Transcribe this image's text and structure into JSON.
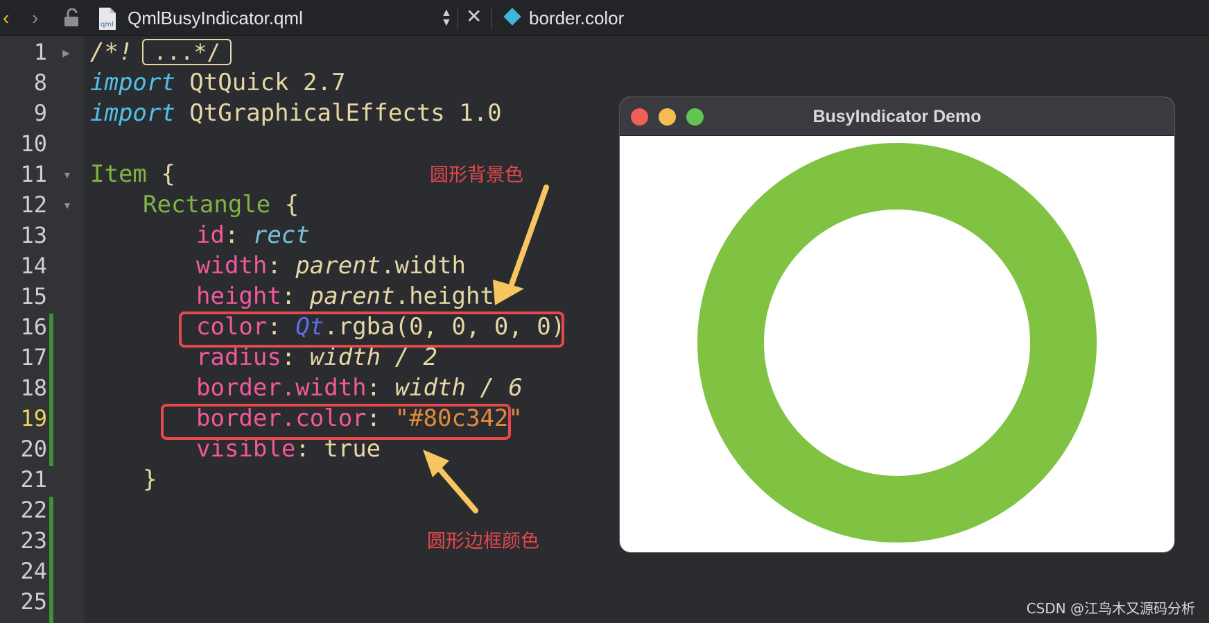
{
  "toolbar": {
    "back_icon": "chevron-left-icon",
    "forward_icon": "chevron-right-icon",
    "lock_icon": "lock-icon",
    "file_icon": "qml-file-icon",
    "file_name": "QmlBusyIndicator.qml",
    "symbol_icon": "diamond-icon",
    "symbol_name": "border.color"
  },
  "editor": {
    "line_numbers": [
      "1",
      "8",
      "9",
      "10",
      "11",
      "12",
      "13",
      "14",
      "15",
      "16",
      "17",
      "18",
      "19",
      "20",
      "21",
      "22",
      "23",
      "24",
      "25"
    ],
    "current_line": "19",
    "folded_text": "...*/",
    "lines": {
      "l1": "/*!",
      "l8_kw": "import",
      "l8_rest": " QtQuick 2.7",
      "l9_kw": "import",
      "l9_rest": " QtGraphicalEffects 1.0",
      "l11_type": "Item",
      "l11_rest": " {",
      "l12_type": "Rectangle",
      "l12_rest": " {",
      "l13_prop": "id",
      "l13_val": "rect",
      "l14_prop": "width",
      "l14_obj": "parent",
      "l14_rest": ".width",
      "l15_prop": "height",
      "l15_obj": "parent",
      "l15_rest": ".height",
      "l16_prop": "color",
      "l16_obj": "Qt",
      "l16_rest": ".rgba(0, 0, 0, 0)",
      "l17_prop": "radius",
      "l17_val": "width / 2",
      "l18_prop": "border.width",
      "l18_val": "width / 6",
      "l19_prop": "border.color",
      "l19_val": "\"#80c342\"",
      "l20_prop": "visible",
      "l20_val": "true",
      "l21": "}"
    }
  },
  "annotations": {
    "bg_color_label": "圆形背景色",
    "border_color_label": "圆形边框颜色"
  },
  "preview": {
    "title": "BusyIndicator Demo",
    "ring_color": "#80c342"
  },
  "watermark": "CSDN @江鸟木又源码分析"
}
